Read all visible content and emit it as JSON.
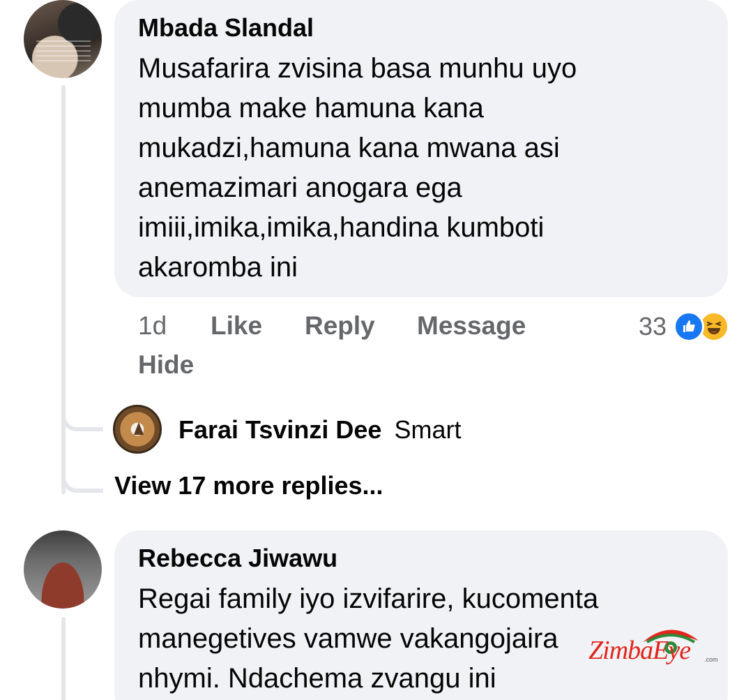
{
  "comments": [
    {
      "author": "Mbada Slandal",
      "body": "Musafarira zvisina basa munhu uyo\nmumba make hamuna kana\nmukadzi,hamuna kana mwana asi\nanemazimari anogara ega\nimiii,imika,imika,handina kumboti\nakaromba ini",
      "time": "1d",
      "actions": {
        "like": "Like",
        "reply": "Reply",
        "message": "Message",
        "hide": "Hide"
      },
      "reaction_count": "33",
      "reaction_icons": [
        "like-icon",
        "haha-icon"
      ],
      "reply_preview": {
        "author": "Farai Tsvinzi Dee",
        "text": "Smart"
      },
      "view_more": "View 17 more replies..."
    },
    {
      "author": "Rebecca Jiwawu",
      "body": "Regai family iyo izvifarire, kucomenta\nmanegetives vamwe vakangojaira\nnhymi. Ndachema zvangu ini"
    }
  ],
  "watermark": {
    "text": "ZimbaEye",
    "suffix": ".com"
  },
  "colors": {
    "bubble": "#f0f2f5",
    "secondary_text": "#65676b",
    "like_blue": "#1877f2",
    "haha_yellow": "#f7b928",
    "watermark_red": "#e1251b"
  }
}
